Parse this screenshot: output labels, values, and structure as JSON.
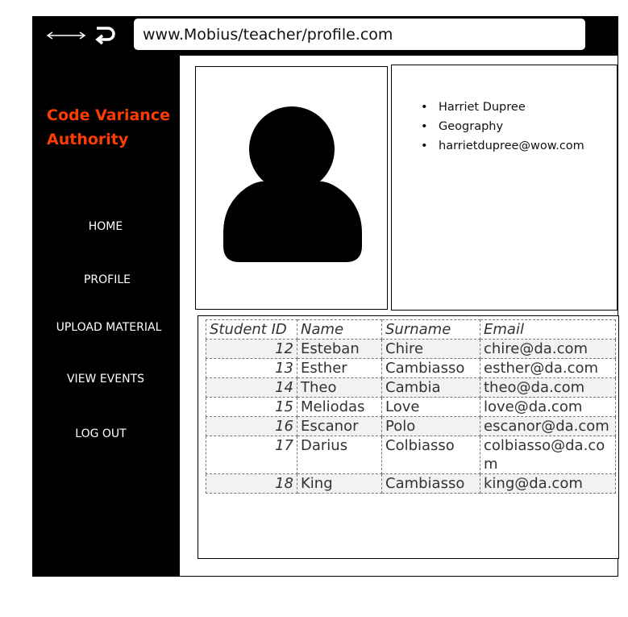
{
  "browser": {
    "url": "www.Mobius/teacher/profile.com"
  },
  "sidebar": {
    "brand_line1": "Code Variance",
    "brand_line2": "Authority",
    "items": [
      {
        "label": "HOME"
      },
      {
        "label": "PROFILE"
      },
      {
        "label": "UPLOAD MATERIAL"
      },
      {
        "label": "VIEW EVENTS"
      },
      {
        "label": "LOG OUT"
      }
    ]
  },
  "profile": {
    "name": "Harriet Dupree",
    "subject": "Geography",
    "email": "harrietdupree@wow.com"
  },
  "table": {
    "headers": [
      "Student ID",
      "Name",
      "Surname",
      "Email"
    ],
    "rows": [
      {
        "id": "12",
        "name": "Esteban",
        "surname": "Chire",
        "email": "chire@da.com"
      },
      {
        "id": "13",
        "name": "Esther",
        "surname": "Cambiasso",
        "email": "esther@da.com"
      },
      {
        "id": "14",
        "name": "Theo",
        "surname": "Cambia",
        "email": "theo@da.com"
      },
      {
        "id": "15",
        "name": "Meliodas",
        "surname": "Love",
        "email": "love@da.com"
      },
      {
        "id": "16",
        "name": "Escanor",
        "surname": "Polo",
        "email": "escanor@da.com"
      },
      {
        "id": "17",
        "name": "Darius",
        "surname": "Colbiasso",
        "email": "colbiasso@da.com"
      },
      {
        "id": "18",
        "name": "King",
        "surname": "Cambiasso",
        "email": "king@da.com"
      }
    ]
  },
  "colors": {
    "brand": "#ff3c00",
    "chrome": "#000000",
    "row_shade": "#f2f2f2"
  }
}
